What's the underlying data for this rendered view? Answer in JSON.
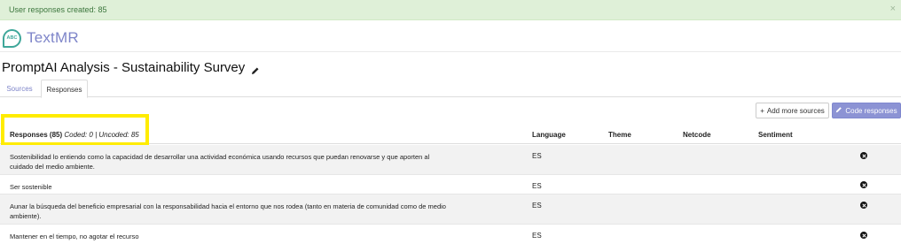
{
  "alert": {
    "message": "User responses created: 85",
    "close": "×"
  },
  "brand": {
    "logo_text": "ABC",
    "name": "TextMR"
  },
  "page": {
    "title": "PromptAI Analysis - Sustainability Survey"
  },
  "tabs": [
    {
      "label": "Sources",
      "active": false
    },
    {
      "label": "Responses",
      "active": true
    }
  ],
  "toolbar": {
    "add_sources_label": "Add more sources",
    "code_responses_label": "Code responses"
  },
  "table": {
    "title": "Responses (85)",
    "counts": "Coded: 0 | Uncoded: 85",
    "columns": {
      "language": "Language",
      "theme": "Theme",
      "netcode": "Netcode",
      "sentiment": "Sentiment"
    },
    "rows": [
      {
        "text": "Sostenibilidad lo entiendo como la capacidad de desarrollar una actividad económica usando recursos que puedan renovarse y que aporten al cuidado del medio ambiente.",
        "language": "ES"
      },
      {
        "text": "Ser sostenible",
        "language": "ES"
      },
      {
        "text": "Aunar la búsqueda del beneficio empresarial con la responsabilidad hacia el entorno que nos rodea (tanto en materia de comunidad como de medio ambiente).",
        "language": "ES"
      },
      {
        "text": "Mantener en el tiempo, no agotar el recurso",
        "language": "ES"
      }
    ]
  },
  "icons": {
    "pencil": "pencil-icon",
    "plus": "plus-icon",
    "close_circle": "close-circle-icon"
  },
  "colors": {
    "alert_bg": "#dff0d8",
    "alert_text": "#3c763d",
    "brand": "#7e85c9",
    "logo": "#3fa79a",
    "primary_button": "#8c93d4",
    "highlight": "#ffec00"
  }
}
